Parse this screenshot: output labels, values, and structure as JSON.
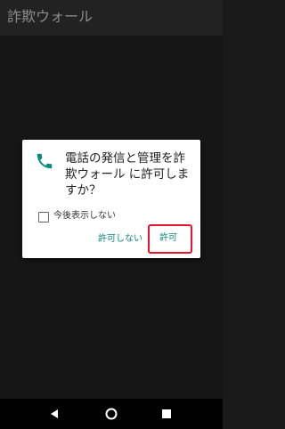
{
  "app": {
    "title": "詐欺ウォール"
  },
  "dialog": {
    "icon": "phone-icon",
    "message": "電話の発信と管理を詐欺ウォール に許可しますか？",
    "checkbox_label": "今後表示しない",
    "checkbox_checked": false,
    "deny_label": "許可しない",
    "allow_label": "許可"
  },
  "nav": {
    "back_icon": "back-icon",
    "home_icon": "home-icon",
    "recents_icon": "recents-icon"
  },
  "colors": {
    "accent": "#0a8a7f",
    "highlight": "#e4152c",
    "background": "#1a1a1a"
  }
}
